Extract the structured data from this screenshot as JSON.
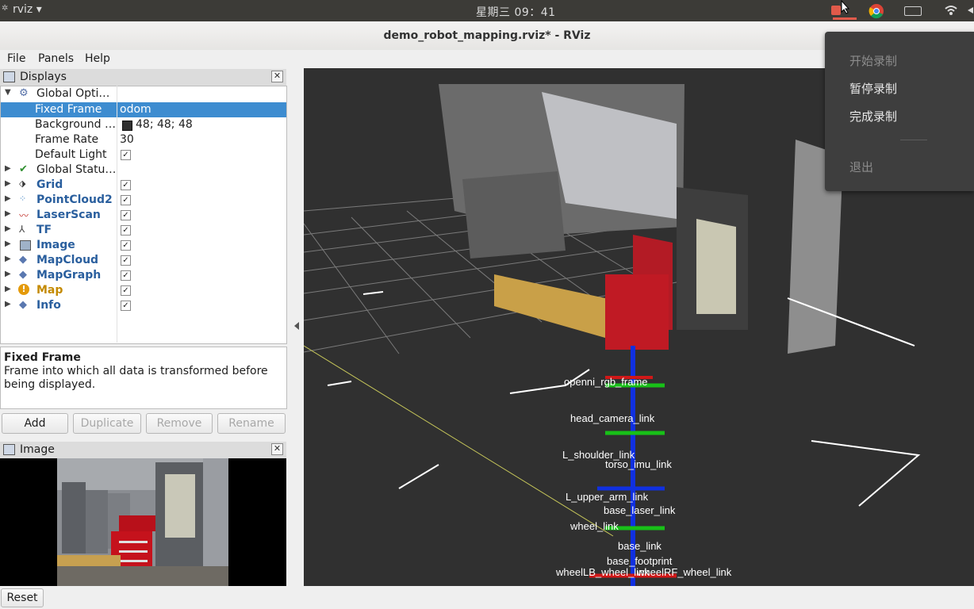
{
  "system_bar": {
    "app_name": "rviz",
    "clock": "星期三 09：41"
  },
  "window": {
    "title": "demo_robot_mapping.rviz* - RViz"
  },
  "menu": {
    "file": "File",
    "panels": "Panels",
    "help": "Help"
  },
  "displays_panel": {
    "title": "Displays",
    "tree": {
      "global_options": "Global Opti…",
      "fixed_frame": {
        "name": "Fixed Frame",
        "value": "odom"
      },
      "background": {
        "name": "Background …",
        "value": "48; 48; 48",
        "color": "#303030"
      },
      "frame_rate": {
        "name": "Frame Rate",
        "value": "30"
      },
      "default_light": {
        "name": "Default Light"
      },
      "global_status": "Global Statu…",
      "displays": [
        {
          "name": "Grid",
          "icon": "grid-icon"
        },
        {
          "name": "PointCloud2",
          "icon": "pointcloud-icon"
        },
        {
          "name": "LaserScan",
          "icon": "laserscan-icon"
        },
        {
          "name": "TF",
          "icon": "tf-icon"
        },
        {
          "name": "Image",
          "icon": "image-icon"
        },
        {
          "name": "MapCloud",
          "icon": "mapcloud-icon"
        },
        {
          "name": "MapGraph",
          "icon": "mapgraph-icon"
        },
        {
          "name": "Map",
          "icon": "warning-icon"
        },
        {
          "name": "Info",
          "icon": "info-icon"
        }
      ]
    },
    "description": {
      "title": "Fixed Frame",
      "text": "Frame into which all data is transformed before being displayed."
    },
    "buttons": {
      "add": "Add",
      "duplicate": "Duplicate",
      "remove": "Remove",
      "rename": "Rename"
    }
  },
  "image_panel": {
    "title": "Image"
  },
  "status_bar": {
    "reset": "Reset"
  },
  "recording_menu": {
    "start": "开始录制",
    "pause": "暂停录制",
    "finish": "完成录制",
    "quit": "退出"
  },
  "tf_labels": [
    "openni_rgb_frame",
    "head_camera_link",
    "L_shoulder_link",
    "torso_imu_link",
    "L_upper_arm_link",
    "base_laser_link",
    "wheel_link",
    "base_link",
    "base_footprint",
    "wheelLB_wheel_link",
    "wheelRF_wheel_link"
  ],
  "colors": {
    "selection": "#3d8cd0",
    "display_name": "#2a5f9e",
    "warning": "#e49a0a"
  }
}
